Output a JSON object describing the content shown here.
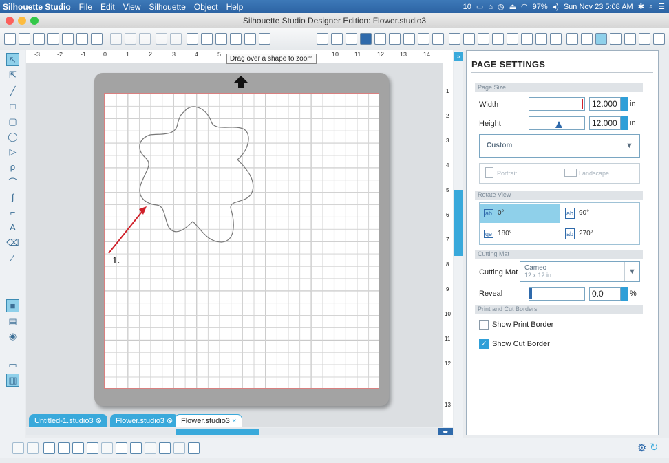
{
  "menubar": {
    "app": "Silhouette Studio",
    "items": [
      "File",
      "Edit",
      "View",
      "Silhouette",
      "Object",
      "Help"
    ],
    "status": {
      "badge": "10",
      "battery": "97%",
      "datetime": "Sun Nov 23  5:08 AM"
    }
  },
  "window": {
    "title": "Silhouette Studio Designer Edition: Flower.studio3"
  },
  "ruler": {
    "labels": [
      "-3",
      "-2",
      "-1",
      "0",
      "1",
      "2",
      "3",
      "4",
      "5",
      "10",
      "11",
      "12",
      "13",
      "14"
    ],
    "vlabels": [
      "1",
      "2",
      "3",
      "4",
      "5",
      "6",
      "7",
      "8",
      "9",
      "10",
      "11",
      "12",
      "13"
    ]
  },
  "tooltip": "Drag over a shape to zoom",
  "annotation": {
    "label": "1."
  },
  "tabs": [
    {
      "label": "Untitled-1.studio3",
      "active": false
    },
    {
      "label": "Flower.studio3",
      "active": false
    },
    {
      "label": "Flower.studio3",
      "active": true
    }
  ],
  "panel": {
    "title": "PAGE SETTINGS",
    "page_size": {
      "header": "Page Size",
      "width_label": "Width",
      "width_value": "12.000",
      "width_unit": "in",
      "height_label": "Height",
      "height_value": "12.000",
      "height_unit": "in",
      "preset": "Custom",
      "portrait": "Portrait",
      "landscape": "Landscape"
    },
    "rotate": {
      "header": "Rotate View",
      "options": [
        "0°",
        "90°",
        "180°",
        "270°"
      ],
      "selected": "0°"
    },
    "mat": {
      "header": "Cutting Mat",
      "label": "Cutting Mat",
      "value": "Cameo",
      "sub": "12 x 12 in",
      "reveal_label": "Reveal",
      "reveal_value": "0.0",
      "reveal_unit": "%"
    },
    "borders": {
      "header": "Print and Cut Borders",
      "print": "Show Print Border",
      "cut": "Show Cut Border",
      "print_checked": false,
      "cut_checked": true
    }
  },
  "colors": {
    "accent": "#39a9db",
    "arrow": "#d0202a",
    "menubar": "#2f6aab"
  }
}
